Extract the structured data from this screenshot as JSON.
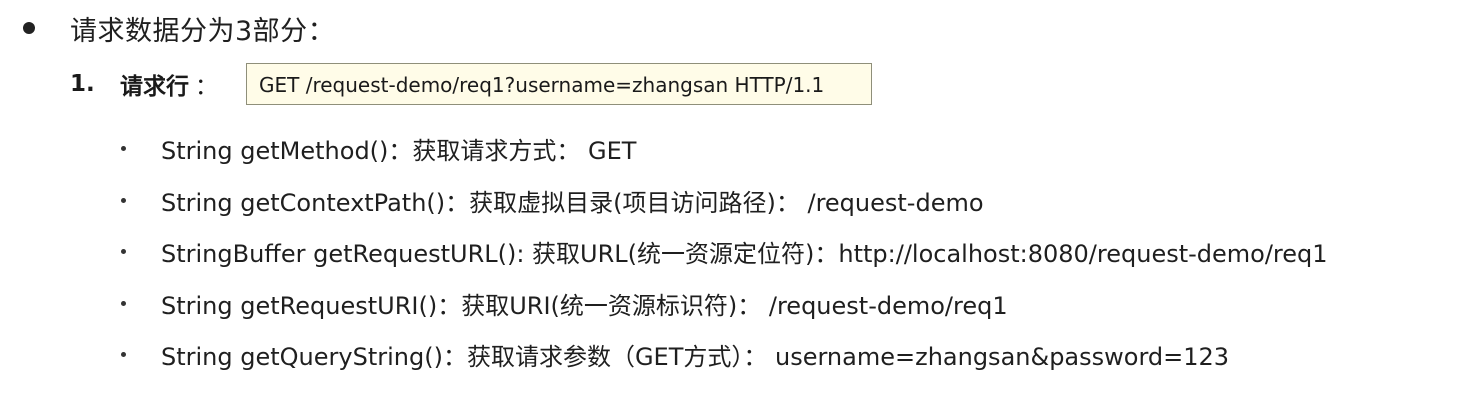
{
  "heading": {
    "text": "请求数据分为3部分："
  },
  "request_line": {
    "number": "1.",
    "label": "请求行",
    "colon": "：",
    "example": "GET /request-demo/req1?username=zhangsan HTTP/1.1"
  },
  "methods": [
    {
      "text": "String getMethod()：获取请求方式：  GET"
    },
    {
      "text": "String getContextPath()：获取虚拟目录(项目访问路径)：  /request-demo"
    },
    {
      "text": "StringBuffer getRequestURL(): 获取URL(统一资源定位符)：http://localhost:8080/request-demo/req1"
    },
    {
      "text": "String getRequestURI()：获取URI(统一资源标识符)：  /request-demo/req1"
    },
    {
      "text": "String getQueryString()：获取请求参数（GET方式）：  username=zhangsan&password=123"
    }
  ]
}
